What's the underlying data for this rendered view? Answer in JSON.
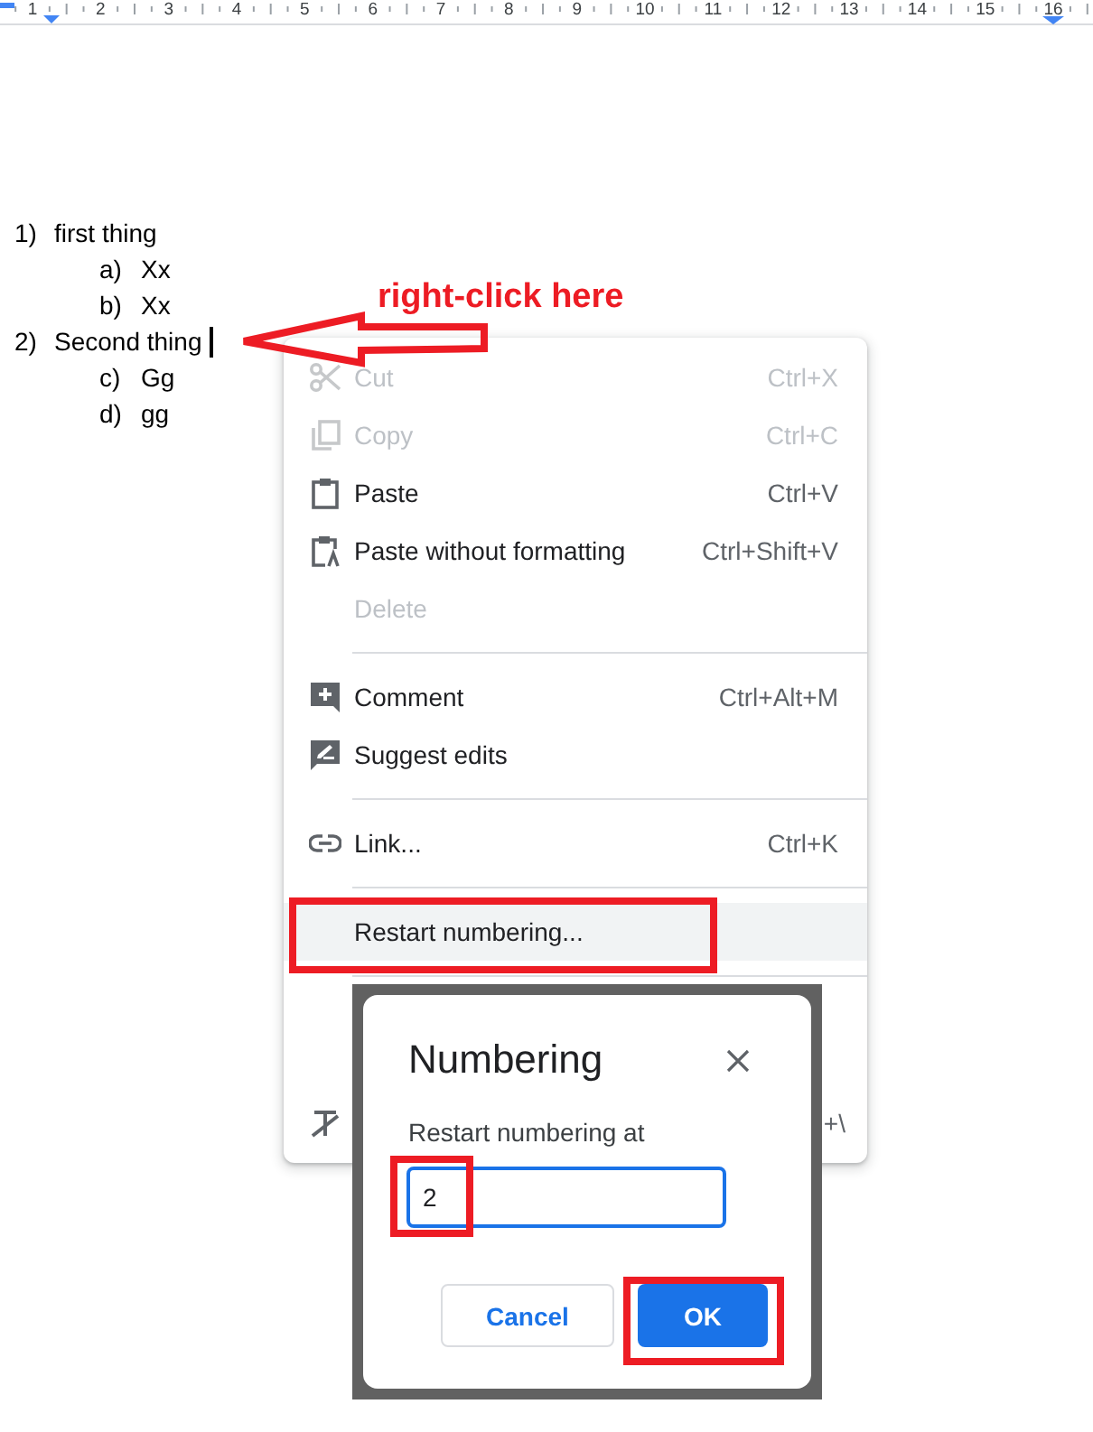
{
  "ruler": {
    "numbers": [
      "1",
      "2",
      "3",
      "4",
      "5",
      "6",
      "7",
      "8",
      "9",
      "10",
      "11",
      "12",
      "13",
      "14",
      "15",
      "16"
    ]
  },
  "document": {
    "list": [
      {
        "marker": "1)",
        "text": "first thing",
        "cursor": false,
        "children": [
          {
            "marker": "a)",
            "text": "Xx"
          },
          {
            "marker": "b)",
            "text": "Xx"
          }
        ]
      },
      {
        "marker": "2)",
        "text": "Second thing",
        "cursor": true,
        "children": [
          {
            "marker": "c)",
            "text": "Gg"
          },
          {
            "marker": "d)",
            "text": "gg"
          }
        ]
      }
    ]
  },
  "annotation": {
    "label": "right-click here"
  },
  "context_menu": {
    "groups": [
      {
        "items": [
          {
            "kind": "item",
            "label": "Cut",
            "shortcut": "Ctrl+X",
            "disabled": true,
            "selected": false
          },
          {
            "kind": "item",
            "label": "Copy",
            "shortcut": "Ctrl+C",
            "disabled": true,
            "selected": false
          },
          {
            "kind": "item",
            "label": "Paste",
            "shortcut": "Ctrl+V",
            "disabled": false,
            "selected": false
          },
          {
            "kind": "item",
            "label": "Paste without formatting",
            "shortcut": "Ctrl+Shift+V",
            "disabled": false,
            "selected": false
          },
          {
            "kind": "item",
            "label": "Delete",
            "disabled": true,
            "selected": false
          }
        ]
      },
      {
        "items": [
          {
            "kind": "item",
            "label": "Comment",
            "shortcut": "Ctrl+Alt+M",
            "disabled": false,
            "selected": false
          },
          {
            "kind": "item",
            "label": "Suggest edits",
            "disabled": false,
            "selected": false
          }
        ]
      },
      {
        "items": [
          {
            "kind": "item",
            "label": "Link...",
            "shortcut": "Ctrl+K",
            "disabled": false,
            "selected": false
          }
        ]
      },
      {
        "items": [
          {
            "kind": "item",
            "label": "Restart numbering...",
            "disabled": false,
            "selected": true
          }
        ]
      },
      {
        "items": [
          {
            "kind": "covered",
            "shortcut": "+\\",
            "disabled": false,
            "selected": false
          }
        ]
      }
    ]
  },
  "dialog": {
    "title": "Numbering",
    "field_label": "Restart numbering at",
    "value": "2",
    "buttons": [
      {
        "kind": "secondary",
        "label": "Cancel"
      },
      {
        "kind": "primary",
        "label": "OK"
      }
    ]
  }
}
